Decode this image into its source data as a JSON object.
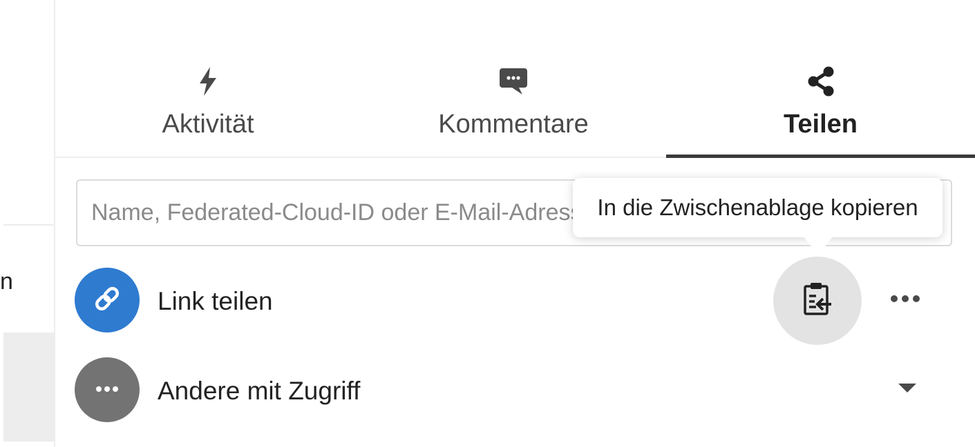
{
  "left_panel": {
    "row_partial_text": "n"
  },
  "tabs": [
    {
      "label": "Aktivität",
      "icon": "lightning-icon",
      "active": false
    },
    {
      "label": "Kommentare",
      "icon": "comment-icon",
      "active": false
    },
    {
      "label": "Teilen",
      "icon": "share-icon",
      "active": true
    }
  ],
  "search": {
    "placeholder": "Name, Federated-Cloud-ID oder E-Mail-Adresse",
    "value": ""
  },
  "share_rows": {
    "link": {
      "label": "Link teilen",
      "avatar_icon": "link-icon",
      "avatar_color": "#2e7bd0",
      "copy_icon": "clipboard-icon",
      "menu_icon": "more-horizontal-icon"
    },
    "others": {
      "label": "Andere mit Zugriff",
      "avatar_icon": "more-horizontal-icon",
      "avatar_color": "#737373",
      "expand_icon": "triangle-down-icon"
    }
  },
  "tooltip": {
    "text": "In die Zwischenablage kopieren"
  }
}
